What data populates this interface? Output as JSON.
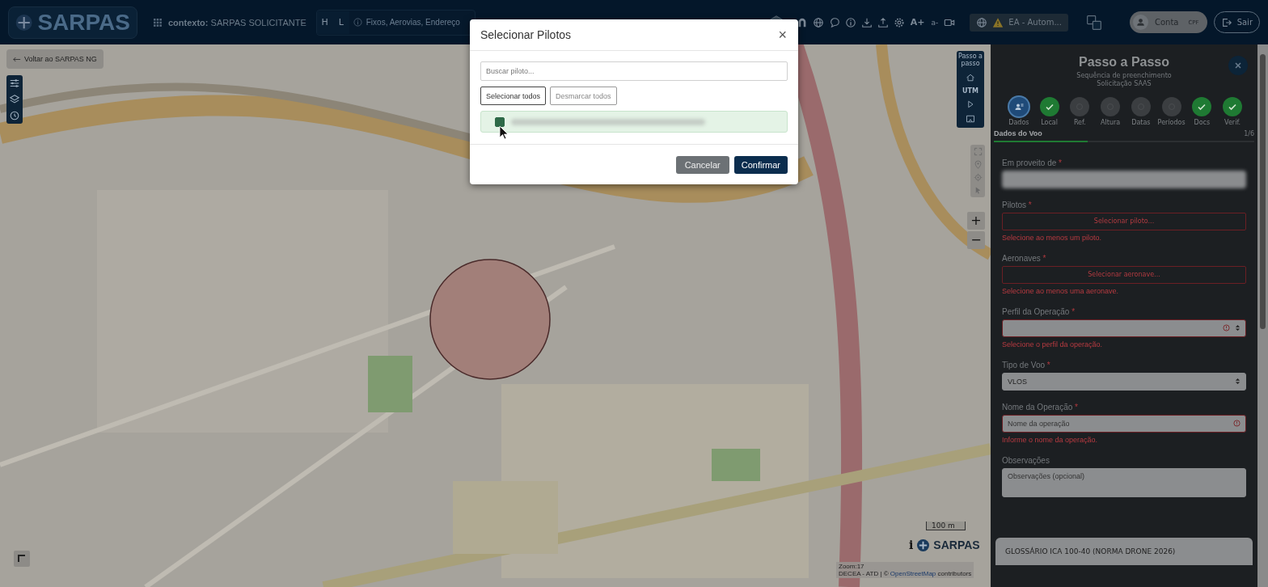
{
  "header": {
    "logo": "SARPAS",
    "context_label": "contexto:",
    "context_value": "SARPAS SOLICITANTE",
    "search_modes": [
      {
        "label": "H",
        "selected": false
      },
      {
        "label": "L",
        "selected": false
      }
    ],
    "search_placeholder": "Fixos, Aerovias, Endereço",
    "font_tools": [
      "A+",
      "a-"
    ],
    "environment": "EA - Autom...",
    "account": "Conta",
    "account_badge": "CPF",
    "logout": "Sair"
  },
  "map": {
    "back_button": "Voltar ao SARPAS NG",
    "step_toolbar_label": "Passo a passo",
    "utm_label": "UTM",
    "zoom_in": "+",
    "zoom_out": "−",
    "scale": "100 m",
    "logo": "SARPAS",
    "info": "i",
    "zoom_level": "Zoom:17",
    "attribution_prefix": "DECEA - ATD | ©",
    "attribution_link": "OpenStreetMap",
    "attribution_suffix": "contributors"
  },
  "panel": {
    "title": "Passo a Passo",
    "subtitle": [
      "Sequência de preenchimento",
      "Solicitação SAAS"
    ],
    "steps": [
      {
        "label": "Dados",
        "current": true
      },
      {
        "label": "Local",
        "current": false,
        "done": true
      },
      {
        "label": "Ref.",
        "current": false,
        "done": false
      },
      {
        "label": "Altura",
        "current": false,
        "done": false
      },
      {
        "label": "Datas",
        "current": false,
        "done": false
      },
      {
        "label": "Períodos",
        "current": false,
        "done": false
      },
      {
        "label": "Docs",
        "current": false,
        "done": true
      },
      {
        "label": "Verif.",
        "current": false,
        "done": true
      }
    ],
    "section": "Dados do Voo",
    "section_count": "1/6",
    "level": 0.36,
    "fields": [
      {
        "kind": "redacted",
        "label": "Em proveito de",
        "mark": "*"
      },
      {
        "kind": "picker",
        "label": "Pilotos",
        "mark": "*",
        "invalid": true,
        "button": "Selecionar piloto...",
        "error": "Selecione ao menos um piloto."
      },
      {
        "kind": "picker",
        "label": "Aeronaves",
        "mark": "*",
        "invalid": true,
        "button": "Selecionar aeronave...",
        "error": "Selecione ao menos uma aeronave."
      },
      {
        "kind": "select",
        "label": "Perfil da Operação",
        "mark": "*",
        "invalid": true,
        "error": "Selecione o perfil da operação."
      },
      {
        "kind": "select",
        "label": "Tipo de Voo",
        "mark": "*",
        "invalid": false,
        "value": "VLOS"
      },
      {
        "kind": "input",
        "label": "Nome da Operação",
        "mark": "*",
        "invalid": true,
        "placeholder": "Nome da operação",
        "error": "Informe o nome da operação."
      },
      {
        "kind": "textarea",
        "label": "Observações",
        "invalid": false,
        "placeholder": "Observações (opcional)"
      }
    ],
    "glossary": "GLOSSÁRIO ICA 100-40 (NORMA DRONE 2026)"
  },
  "modal": {
    "title": "Selecionar Pilotos",
    "close": "×",
    "search_placeholder": "Buscar piloto...",
    "select_all": "Selecionar todos",
    "deselect_all": "Desmarcar todos",
    "deselect_disabled": true,
    "pilots": [
      {
        "checked": true,
        "selected": true
      }
    ],
    "cancel": "Cancelar",
    "confirm": "Confirmar"
  }
}
